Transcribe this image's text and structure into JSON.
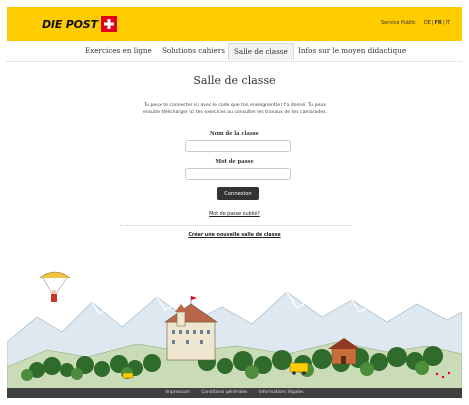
{
  "header": {
    "logo_text": "DIE POST",
    "service_public": "Service Public",
    "languages": [
      "DE",
      "FR",
      "IT"
    ],
    "active_language": "FR",
    "brand_color": "#ffcc00",
    "logo_cross_color": "#e2001a"
  },
  "nav": {
    "items": [
      "Exercices en ligne",
      "Solutions cahiers",
      "Salle de classe",
      "Infos sur le moyen didactique"
    ],
    "active": "Salle de classe"
  },
  "main": {
    "title": "Salle de classe",
    "intro_line1": "Tu peux te connecter ici avec le code que ton enseignant(e) t'a donné. Tu peux",
    "intro_line2": "ensuite télécharger ici tes exercices ou consulter les travaux de tes camarades.",
    "class_name_label": "Nom de la classe",
    "class_name_value": "",
    "password_label": "Mot de passe",
    "password_value": "",
    "login_button": "Connexion",
    "forgot_password": "Mot de passe oublié?",
    "create_class": "Créer une nouvelle salle de classe"
  },
  "footer": {
    "links": [
      "Impressum",
      "Conditions générales",
      "Informations légales"
    ]
  }
}
